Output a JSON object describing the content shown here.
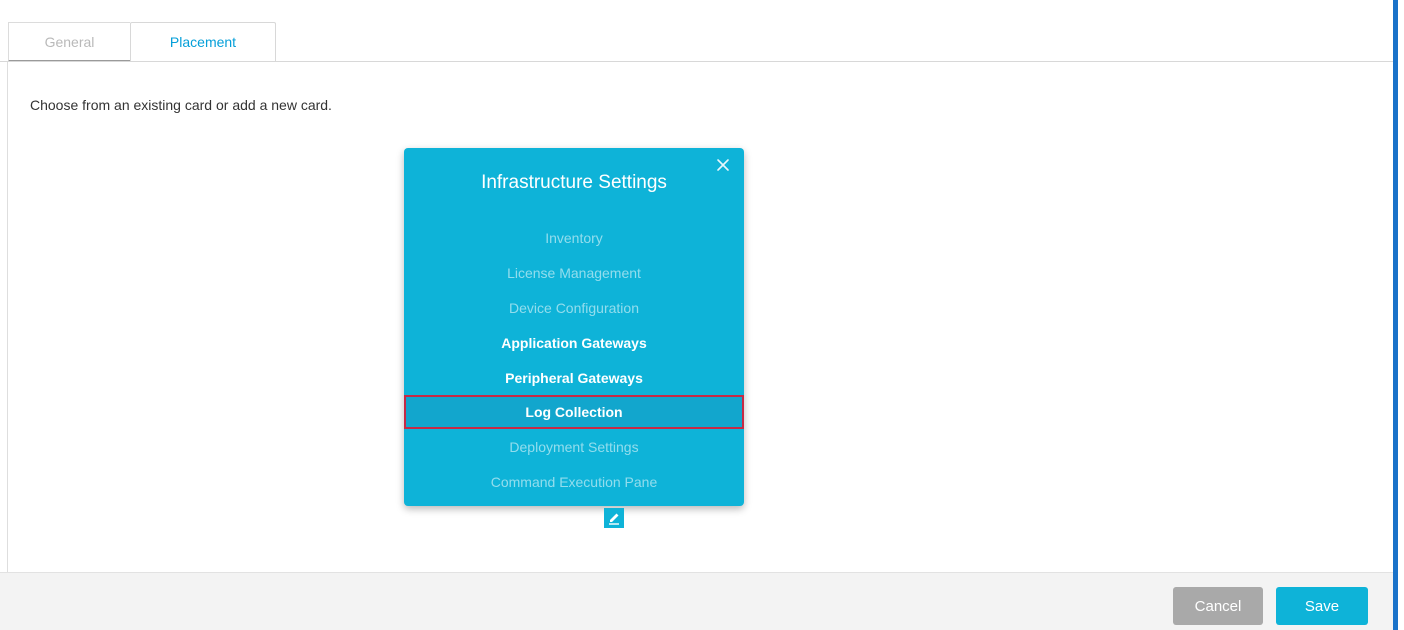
{
  "tabs": [
    {
      "label": "General",
      "state": "inactive"
    },
    {
      "label": "Placement",
      "state": "active"
    }
  ],
  "instructions": "Choose from an existing card or add a new card.",
  "card": {
    "title": "Infrastructure Settings",
    "close_icon": "close-icon",
    "items": [
      {
        "label": "Inventory",
        "state": "dimmed"
      },
      {
        "label": "License Management",
        "state": "dimmed"
      },
      {
        "label": "Device Configuration",
        "state": "dimmed"
      },
      {
        "label": "Application Gateways",
        "state": "active"
      },
      {
        "label": "Peripheral Gateways",
        "state": "active"
      },
      {
        "label": "Log Collection",
        "state": "highlighted"
      },
      {
        "label": "Deployment Settings",
        "state": "dimmed"
      },
      {
        "label": "Command Execution Pane",
        "state": "dimmed"
      }
    ],
    "edit_icon": "pencil-icon",
    "color": "#0eb3d8",
    "highlight_border_color": "#c62a45"
  },
  "footer": {
    "cancel_label": "Cancel",
    "save_label": "Save"
  },
  "colors": {
    "accent": "#049fd9",
    "save_button": "#0eb3d8",
    "cancel_button": "#a9a9a9",
    "right_stripe": "#1a72c9"
  }
}
